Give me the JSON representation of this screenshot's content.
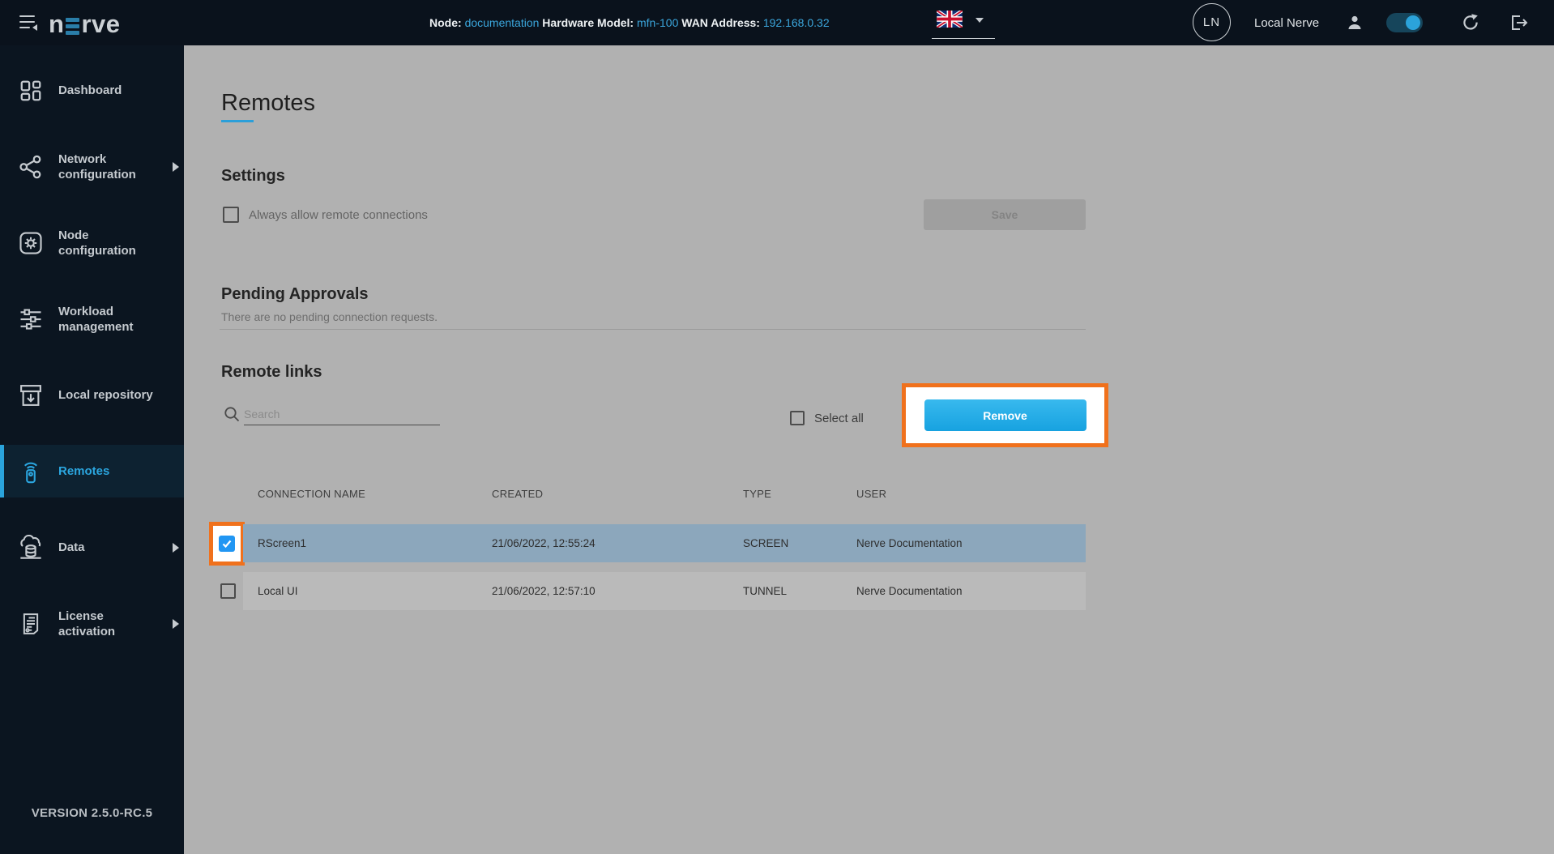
{
  "topbar": {
    "logo_n": "n",
    "logo_rve": "rve",
    "node_label": "Node:",
    "node_value": "documentation",
    "hw_label": "Hardware Model:",
    "hw_value": "mfn-100",
    "wan_label": "WAN Address:",
    "wan_value": "192.168.0.32",
    "avatar_initials": "LN",
    "username": "Local Nerve"
  },
  "sidebar": {
    "items": [
      {
        "label": "Dashboard",
        "icon": "dashboard-icon",
        "expandable": false,
        "active": false
      },
      {
        "label": "Network configuration",
        "icon": "network-icon",
        "expandable": true,
        "active": false
      },
      {
        "label": "Node configuration",
        "icon": "node-config-icon",
        "expandable": false,
        "active": false
      },
      {
        "label": "Workload management",
        "icon": "workload-icon",
        "expandable": false,
        "active": false
      },
      {
        "label": "Local repository",
        "icon": "repository-icon",
        "expandable": false,
        "active": false
      },
      {
        "label": "Remotes",
        "icon": "remote-icon",
        "expandable": false,
        "active": true
      },
      {
        "label": "Data",
        "icon": "data-icon",
        "expandable": true,
        "active": false
      },
      {
        "label": "License activation",
        "icon": "license-icon",
        "expandable": true,
        "active": false
      }
    ],
    "version": "VERSION 2.5.0-RC.5"
  },
  "main": {
    "title": "Remotes",
    "settings": {
      "heading": "Settings",
      "checkbox_label": "Always allow remote connections",
      "checkbox_checked": false,
      "save_label": "Save",
      "save_enabled": false
    },
    "pending": {
      "heading": "Pending Approvals",
      "empty_text": "There are no pending connection requests."
    },
    "remote_links": {
      "heading": "Remote links",
      "search_placeholder": "Search",
      "search_value": "",
      "select_all_label": "Select all",
      "select_all_checked": false,
      "remove_label": "Remove",
      "table": {
        "headers": [
          "CONNECTION NAME",
          "CREATED",
          "TYPE",
          "USER"
        ],
        "rows": [
          {
            "name": "RScreen1",
            "created": "21/06/2022, 12:55:24",
            "type": "SCREEN",
            "user": "Nerve Documentation",
            "checked": true,
            "selected": true
          },
          {
            "name": "Local UI",
            "created": "21/06/2022, 12:57:10",
            "type": "TUNNEL",
            "user": "Nerve Documentation",
            "checked": false,
            "selected": false
          }
        ]
      }
    }
  },
  "colors": {
    "topbar_bg": "#0a121c",
    "sidebar_bg": "#0b1520",
    "active_item_bg": "#0d2231",
    "accent_blue": "#2ba6df",
    "link_blue": "#3ba6dc",
    "highlight_orange": "#f0711c",
    "selected_row": "#8ca7bc",
    "checkbox_checked_blue": "#2196f3",
    "remove_button_blue": "#1fa8e3",
    "main_bg": "#b1b1b1"
  }
}
